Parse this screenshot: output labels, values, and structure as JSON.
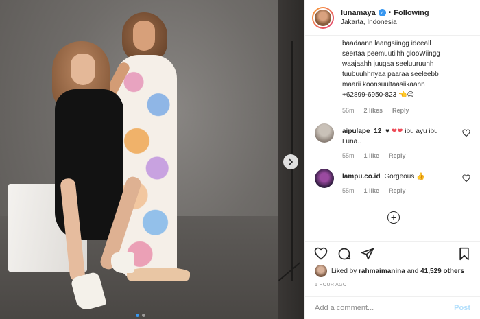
{
  "header": {
    "username": "lunamaya",
    "separator": "•",
    "follow_status": "Following",
    "location": "Jakarta, Indonesia"
  },
  "caption": {
    "text": "baadaann laangsiingg ideeall\nseertaa peemuutiihh glooWiingg\nwaajaahh juugaa seeluuruuhh\ntuubuuhhnyaa paaraa seeleebb\nmaarii koonsuultaasiikaann\n+62899-6950-823 👈😊",
    "time": "56m",
    "likes": "2 likes",
    "reply": "Reply"
  },
  "comments": [
    {
      "user": "aipulape_12",
      "text_prefix": "♥",
      "hearts": "❤❤",
      "text_suffix": "ibu ayu ibu Luna..",
      "time": "55m",
      "likes": "1 like",
      "reply": "Reply"
    },
    {
      "user": "lampu.co.id",
      "text": "Gorgeous 👍",
      "time": "55m",
      "likes": "1 like",
      "reply": "Reply"
    }
  ],
  "likes_summary": {
    "prefix": "Liked by",
    "user": "rahmaimanina",
    "joiner": "and",
    "count": "41,529 others"
  },
  "timestamp": "1 HOUR AGO",
  "add_comment": {
    "placeholder": "Add a comment...",
    "post_label": "Post"
  },
  "carousel": {
    "total": 2,
    "active": 1
  },
  "colors": {
    "accent": "#3897f0",
    "heart": "#ed4956",
    "muted": "#8e8e8e",
    "post_disabled": "#b2dffc"
  },
  "icons": [
    "verified-badge-icon",
    "chevron-right-icon",
    "heart-icon",
    "comment-icon",
    "share-icon",
    "bookmark-icon",
    "plus-circle-icon"
  ]
}
